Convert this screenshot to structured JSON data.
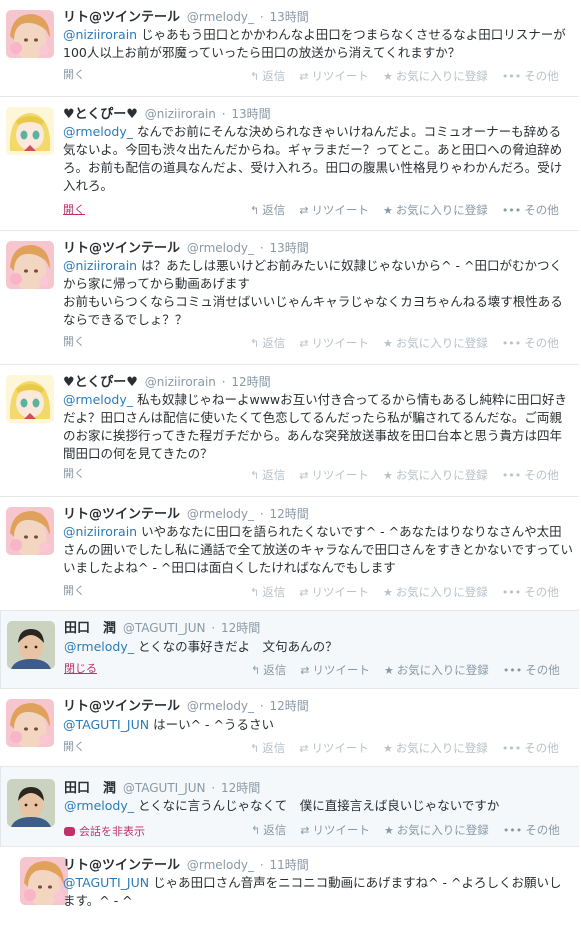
{
  "labels": {
    "open": "開く",
    "close": "閉じる",
    "hide_convo": "会話を非表示",
    "reply": "返信",
    "retweet": "リツイート",
    "favorite": "お気に入りに登録",
    "more": "その他",
    "sep": "·"
  },
  "tweets": [
    {
      "name": "リト@ツインテール",
      "handle": "@rmelody_",
      "time": "13時間",
      "mention": "@niziirorain",
      "text": " じゃあもう田口とかかわんなよ田口をつまらなくさせるなよ田口リスナーが100人以上お前が邪魔っていったら田口の放送から消えてくれますか？"
    },
    {
      "name": "♥とくぴー♥",
      "handle": "@niziirorain",
      "time": "13時間",
      "mention": "@rmelody_",
      "text": " なんでお前にそんな決められなきゃいけねんだよ。コミュオーナーも辞める気ないよ。今回も渋々出たんだからね。ギャラまだー？ってとこ。あと田口への脅迫辞めろ。お前も配信の道具なんだよ、受け入れろ。田口の腹黒い性格見りゃわかんだろ。受け入れろ。"
    },
    {
      "name": "リト@ツインテール",
      "handle": "@rmelody_",
      "time": "13時間",
      "mention": "@niziirorain",
      "text": " は？あたしは悪いけどお前みたいに奴隷じゃないから^ - ^田口がむかつくから家に帰ってから動画あげます\nお前もいらつくならコミュ消せばいいじゃんキャラじゃなくカヨちゃんねる壊す根性あるならできるでしょ？？"
    },
    {
      "name": "♥とくぴー♥",
      "handle": "@niziirorain",
      "time": "12時間",
      "mention": "@rmelody_",
      "text": " 私も奴隷じゃねーよwwwお互い付き合ってるから情もあるし純粋に田口好きだよ？田口さんは配信に使いたくて色恋してるんだったら私が騙されてるんだな。ご両親のお家に挨拶行ってきた程ガチだから。あんな突発放送事故を田口台本と思う貴方は四年間田口の何を見てきたの？"
    },
    {
      "name": "リト@ツインテール",
      "handle": "@rmelody_",
      "time": "12時間",
      "mention": "@niziirorain",
      "text": " いやあなたに田口を語られたくないです^ - ^あなたはりなりなさんや太田さんの囲いでしたし私に通話で全て放送のキャラなんで田口さんをすきとかないですっていいましたよね^ - ^田口は面白くしたければなんでもします"
    },
    {
      "name": "田口　潤",
      "handle": "@TAGUTI_JUN",
      "time": "12時間",
      "mention": "@rmelody_",
      "text": " とくなの事好きだよ　文句あんの？"
    },
    {
      "name": "リト@ツインテール",
      "handle": "@rmelody_",
      "time": "12時間",
      "mention": "@TAGUTI_JUN",
      "text": " はーい^ - ^うるさい"
    },
    {
      "name": "田口　潤",
      "handle": "@TAGUTI_JUN",
      "time": "12時間",
      "mention": "@rmelody_",
      "text": " とくなに言うんじゃなくて　僕に直接言えば良いじゃないですか"
    },
    {
      "name": "リト@ツインテール",
      "handle": "@rmelody_",
      "time": "11時間",
      "mention": "@TAGUTI_JUN",
      "text": " じゃあ田口さん音声をニコニコ動画にあげますね^ - ^よろしくお願いします。^ - ^"
    }
  ]
}
